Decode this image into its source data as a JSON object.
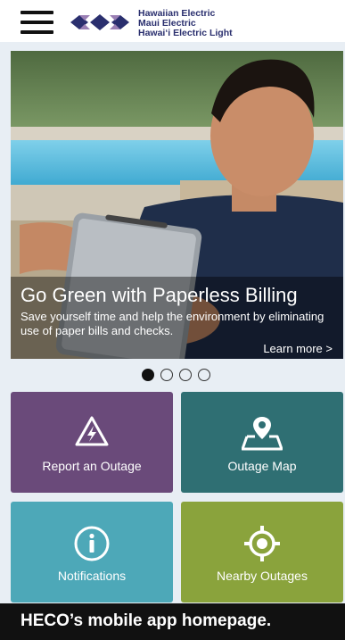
{
  "header": {
    "menu_icon": "hamburger-menu-icon",
    "logo_icon": "heco-diamond-logo-icon",
    "logo_lines": [
      "Hawaiian Electric",
      "Maui Electric",
      "Hawai‘i Electric Light"
    ]
  },
  "hero": {
    "title": "Go Green with Paperless Billing",
    "description": "Save yourself time and help the environment by eliminating use of paper bills and checks.",
    "link": "Learn more >"
  },
  "carousel": {
    "total": 4,
    "active_index": 0
  },
  "tiles": [
    {
      "label": "Report an Outage",
      "icon": "lightning-warning-icon",
      "color": "#6a4a7a"
    },
    {
      "label": "Outage Map",
      "icon": "map-pin-icon",
      "color": "#2f6f73"
    },
    {
      "label": "Notifications",
      "icon": "info-icon",
      "color": "#4da8b8"
    },
    {
      "label": "Nearby Outages",
      "icon": "target-location-icon",
      "color": "#8aa33c"
    }
  ],
  "caption": "HECO’s mobile app homepage.",
  "colors": {
    "brand_navy": "#2a2f6e",
    "page_background": "#e8eef4"
  }
}
